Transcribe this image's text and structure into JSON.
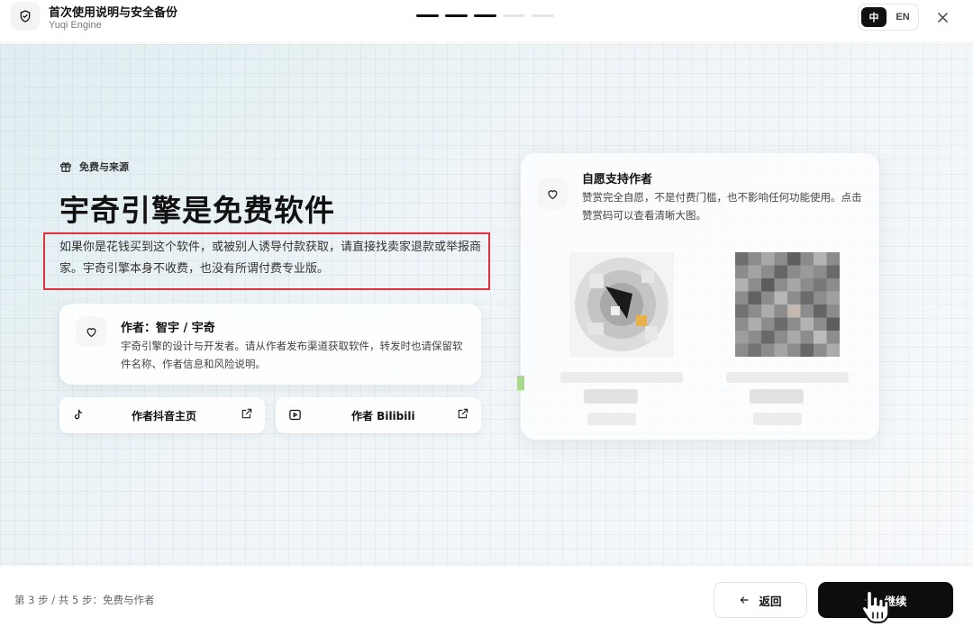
{
  "header": {
    "title": "首次使用说明与安全备份",
    "subtitle": "Yuqi Engine",
    "steps_total": 5,
    "steps_done": 3,
    "lang_zh": "中",
    "lang_en": "EN",
    "active_lang": "zh"
  },
  "main": {
    "section_tag": "免费与来源",
    "headline": "宇奇引擎是免费软件",
    "description": "如果你是花钱买到这个软件，或被别人诱导付款获取，请直接找卖家退款或举报商家。宇奇引擎本身不收费，也没有所谓付费专业版。",
    "author": {
      "name": "作者：智宇 / 宇奇",
      "description": "宇奇引擎的设计与开发者。请从作者发布渠道获取软件，转发时也请保留软件名称、作者信息和风险说明。"
    },
    "links": {
      "douyin": "作者抖音主页",
      "bilibili": "作者 Bilibili"
    },
    "support": {
      "title": "自愿支持作者",
      "description": "赞赏完全自愿，不是付费门槛，也不影响任何功能使用。点击赞赏码可以查看清晰大图。"
    }
  },
  "footer": {
    "step_label": "第 3 步 / 共 5 步：免费与作者",
    "back_label": "返回",
    "continue_label": "继续"
  },
  "colors": {
    "accent_dark": "#111111",
    "highlight_box": "#e0323a"
  }
}
